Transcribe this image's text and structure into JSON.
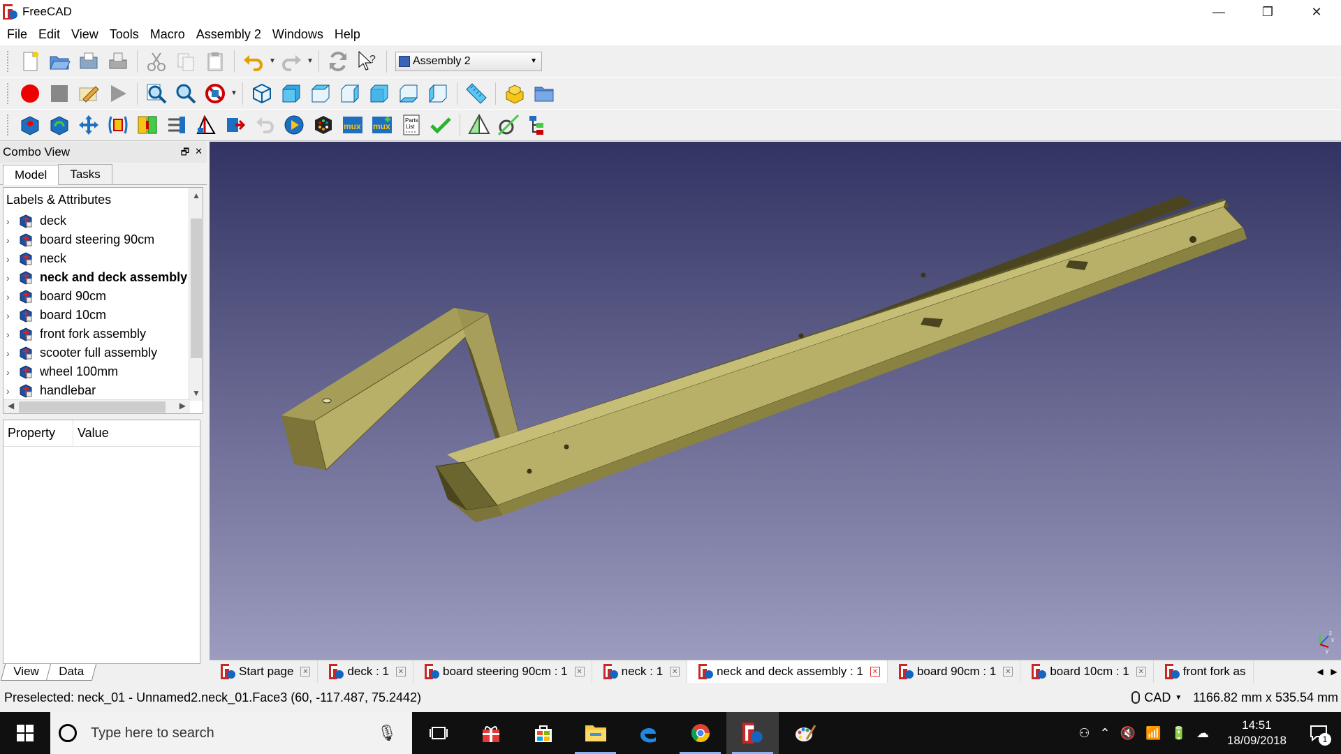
{
  "window": {
    "title": "FreeCAD",
    "min": "—",
    "max": "❐",
    "close": "✕"
  },
  "menu": [
    "File",
    "Edit",
    "View",
    "Tools",
    "Macro",
    "Assembly 2",
    "Windows",
    "Help"
  ],
  "toolbar": {
    "workbench": "Assembly 2"
  },
  "combo": {
    "title": "Combo View",
    "tabs": [
      "Model",
      "Tasks"
    ],
    "tree_header": "Labels & Attributes",
    "tree_items": [
      "deck",
      "board steering 90cm",
      "neck",
      "neck and deck assembly",
      "board 90cm",
      "board 10cm",
      "front fork assembly",
      "scooter full assembly",
      "wheel 100mm",
      "handlebar"
    ],
    "property_header": {
      "property": "Property",
      "value": "Value"
    },
    "bottom_tabs": [
      "View",
      "Data"
    ]
  },
  "doctabs": [
    "Start page",
    "deck : 1",
    "board steering 90cm : 1",
    "neck : 1",
    "neck and deck assembly : 1",
    "board 90cm : 1",
    "board 10cm : 1",
    "front fork as"
  ],
  "status": {
    "preselected": "Preselected: neck_01 - Unnamed2.neck_01.Face3 (60, -117.487, 75.2442)",
    "nav_style": "CAD",
    "dimensions": "1166.82 mm x 535.54 mm"
  },
  "taskbar": {
    "search_placeholder": "Type here to search",
    "time": "14:51",
    "date": "18/09/2018",
    "notifications": "1"
  },
  "colors": {
    "wood_top": "#b8b068",
    "wood_side": "#7c7438",
    "wood_dark": "#4a4520",
    "view_top": "#333363",
    "view_bottom": "#9c9cbf"
  }
}
